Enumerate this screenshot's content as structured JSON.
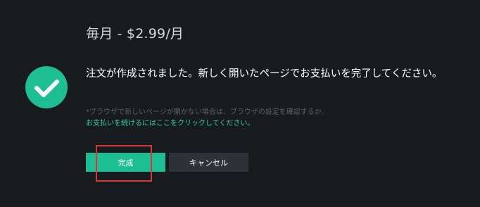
{
  "plan": {
    "title": "毎月 - $2.99/月"
  },
  "status": {
    "icon": "checkmark-circle-icon",
    "accent_color": "#1fbd93",
    "message": "注文が作成されました。新しく開いたページでお支払いを完了してください。"
  },
  "help": {
    "note": "*ブラウザで新しいページが開かない場合は、ブラウザの設定を確認するか、",
    "link": "お支払いを続けるにはここをクリックしてください。"
  },
  "actions": {
    "done_label": "完成",
    "cancel_label": "キャンセル"
  },
  "annotation": {
    "highlight_color": "#d8363a"
  }
}
